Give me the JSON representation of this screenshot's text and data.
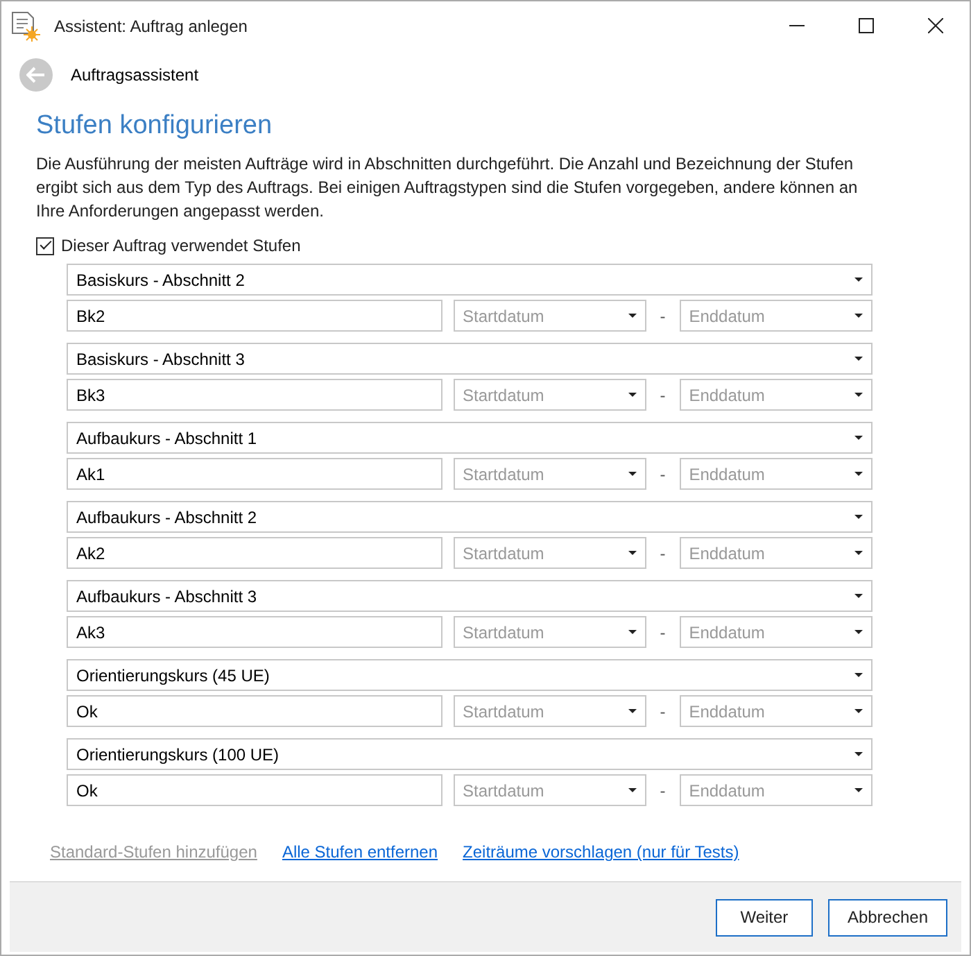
{
  "window": {
    "title": "Assistent: Auftrag anlegen"
  },
  "nav": {
    "title": "Auftragsassistent"
  },
  "heading": "Stufen konfigurieren",
  "description": "Die Ausführung der meisten Aufträge wird in Abschnitten durchgeführt. Die Anzahl und Bezeichnung der Stufen ergibt sich aus dem Typ des Auftrags. Bei einigen Auftragstypen sind die Stufen vorgegeben, andere können an Ihre Anforderungen angepasst werden.",
  "uses_stages": {
    "label": "Dieser Auftrag verwendet Stufen",
    "checked": true
  },
  "stages": [
    {
      "type": "Basiskurs - Abschnitt 2",
      "name": "Bk2",
      "start_placeholder": "Startdatum",
      "separator": "-",
      "end_placeholder": "Enddatum"
    },
    {
      "type": "Basiskurs - Abschnitt 3",
      "name": "Bk3",
      "start_placeholder": "Startdatum",
      "separator": "-",
      "end_placeholder": "Enddatum"
    },
    {
      "type": "Aufbaukurs - Abschnitt 1",
      "name": "Ak1",
      "start_placeholder": "Startdatum",
      "separator": "-",
      "end_placeholder": "Enddatum"
    },
    {
      "type": "Aufbaukurs - Abschnitt 2",
      "name": "Ak2",
      "start_placeholder": "Startdatum",
      "separator": "-",
      "end_placeholder": "Enddatum"
    },
    {
      "type": "Aufbaukurs - Abschnitt 3",
      "name": "Ak3",
      "start_placeholder": "Startdatum",
      "separator": "-",
      "end_placeholder": "Enddatum"
    },
    {
      "type": "Orientierungskurs (45 UE)",
      "name": "Ok",
      "start_placeholder": "Startdatum",
      "separator": "-",
      "end_placeholder": "Enddatum"
    },
    {
      "type": "Orientierungskurs (100 UE)",
      "name": "Ok",
      "start_placeholder": "Startdatum",
      "separator": "-",
      "end_placeholder": "Enddatum"
    }
  ],
  "links": [
    {
      "label": "Standard-Stufen hinzufügen",
      "disabled": true
    },
    {
      "label": "Alle Stufen entfernen",
      "disabled": false
    },
    {
      "label": "Zeiträume vorschlagen (nur für Tests)",
      "disabled": false
    }
  ],
  "buttons": [
    {
      "label": "Weiter"
    },
    {
      "label": "Abbrechen"
    }
  ]
}
